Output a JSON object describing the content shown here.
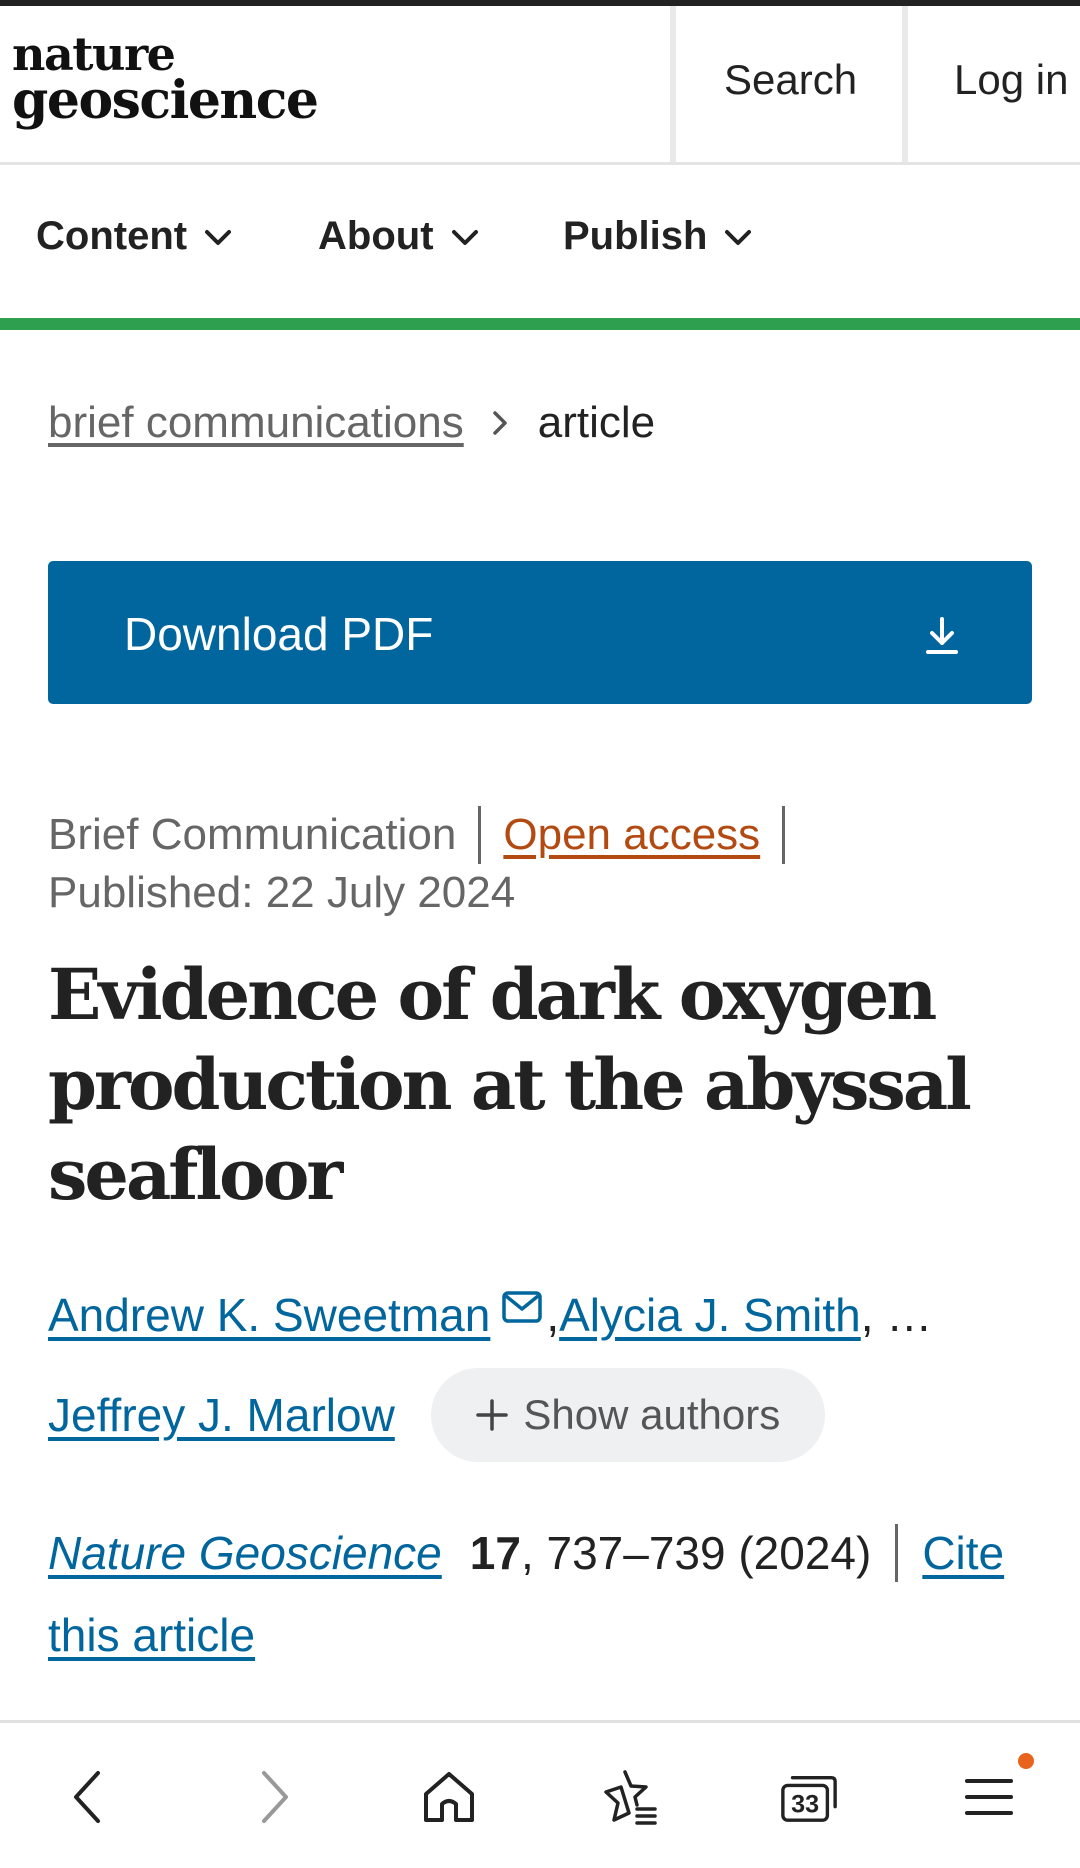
{
  "header": {
    "logo_line1": "nature",
    "logo_line2": "geoscience",
    "search_label": "Search",
    "login_label": "Log in"
  },
  "nav": {
    "items": [
      {
        "label": "Content"
      },
      {
        "label": "About"
      },
      {
        "label": "Publish"
      }
    ]
  },
  "breadcrumb": {
    "parent": "brief communications",
    "current": "article"
  },
  "pdf_button": {
    "label": "Download PDF",
    "icon": "download-icon"
  },
  "article": {
    "type": "Brief Communication",
    "access": "Open access",
    "published": "Published: 22 July 2024",
    "title": "Evidence of dark oxygen production at the abyssal seafloor",
    "authors": {
      "first": "Andrew K. Sweetman",
      "second": "Alycia J. Smith",
      "ellipsis": ", …",
      "last": "Jeffrey J. Marlow",
      "show_authors_label": "Show authors"
    },
    "citation": {
      "journal": "Nature Geoscience",
      "volume": "17",
      "pages_year": ", 737–739 (2024)",
      "cite_line1": "Cite",
      "cite_line2": "this article"
    }
  },
  "browser_bar": {
    "tab_count": "33",
    "icons": [
      "back-icon",
      "forward-icon",
      "home-icon",
      "bookmarks-icon",
      "tabs-icon",
      "menu-icon"
    ]
  },
  "colors": {
    "accent_blue": "#01669d",
    "nav_green": "#2e9e4f",
    "open_access": "#b34a12",
    "notification_dot": "#e8631c"
  }
}
